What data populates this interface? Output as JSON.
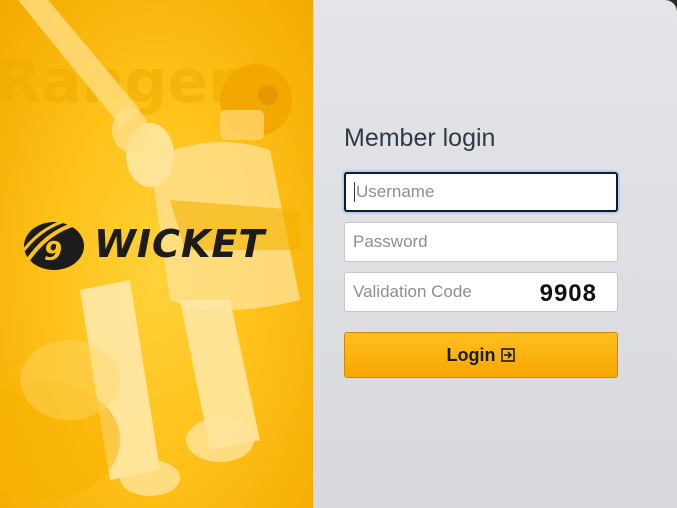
{
  "brand": {
    "logo_mark": "9",
    "logo_text": "WICKET"
  },
  "login": {
    "title": "Member login",
    "username_placeholder": "Username",
    "password_placeholder": "Password",
    "validation_placeholder": "Validation Code",
    "validation_code": "9908",
    "submit_label": "Login",
    "submit_icon": "sign-in-icon"
  },
  "colors": {
    "accent": "#FFB800",
    "title_text": "#2E3A48",
    "focus_border": "#0D1B2A"
  }
}
